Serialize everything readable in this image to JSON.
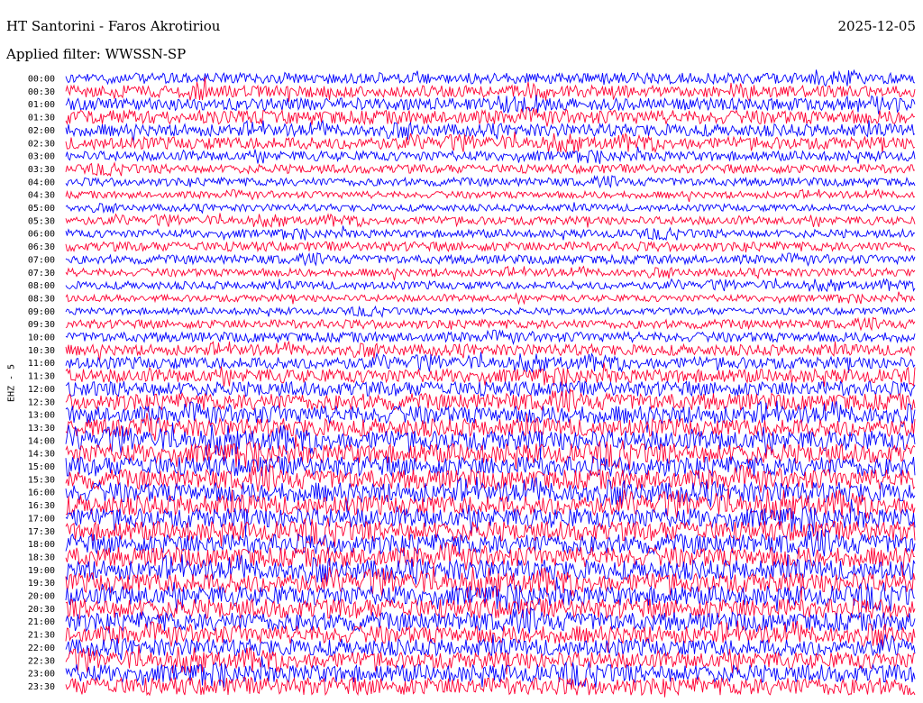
{
  "header": {
    "station": "HT Santorini - Faros Akrotiriou",
    "date": "2025-12-05",
    "filter": "Applied filter: WWSSN-SP"
  },
  "chart_data": {
    "type": "line",
    "title": "HT Santorini - Faros Akrotiriou",
    "subtitle": "Applied filter: WWSSN-SP",
    "date": "2025-12-05",
    "ylabel": "EHZ - 5",
    "row_labels": [
      "00:00",
      "00:30",
      "01:00",
      "01:30",
      "02:00",
      "02:30",
      "03:00",
      "03:30",
      "04:00",
      "04:30",
      "05:00",
      "05:30",
      "06:00",
      "06:30",
      "07:00",
      "07:30",
      "08:00",
      "08:30",
      "09:00",
      "09:30",
      "10:00",
      "10:30",
      "11:00",
      "11:30",
      "12:00",
      "12:30",
      "13:00",
      "13:30",
      "14:00",
      "14:30",
      "15:00",
      "15:30",
      "16:00",
      "16:30",
      "17:00",
      "17:30",
      "18:00",
      "18:30",
      "19:00",
      "19:30",
      "20:00",
      "20:30",
      "21:00",
      "21:30",
      "22:00",
      "22:30",
      "23:00",
      "23:30"
    ],
    "trace_colors": [
      "#0000ff",
      "#ff0033",
      "#0000ff",
      "#ff0033"
    ],
    "relative_amplitude": [
      0.55,
      0.6,
      0.62,
      0.7,
      0.62,
      0.62,
      0.5,
      0.45,
      0.42,
      0.35,
      0.35,
      0.42,
      0.42,
      0.48,
      0.45,
      0.4,
      0.4,
      0.35,
      0.35,
      0.45,
      0.5,
      0.55,
      0.6,
      0.7,
      0.75,
      0.85,
      0.9,
      0.9,
      1.0,
      1.0,
      1.0,
      1.0,
      1.0,
      1.0,
      1.0,
      1.0,
      1.0,
      1.0,
      1.0,
      1.0,
      1.0,
      1.0,
      0.95,
      0.9,
      0.85,
      0.85,
      0.9,
      0.9
    ],
    "grid": false
  }
}
